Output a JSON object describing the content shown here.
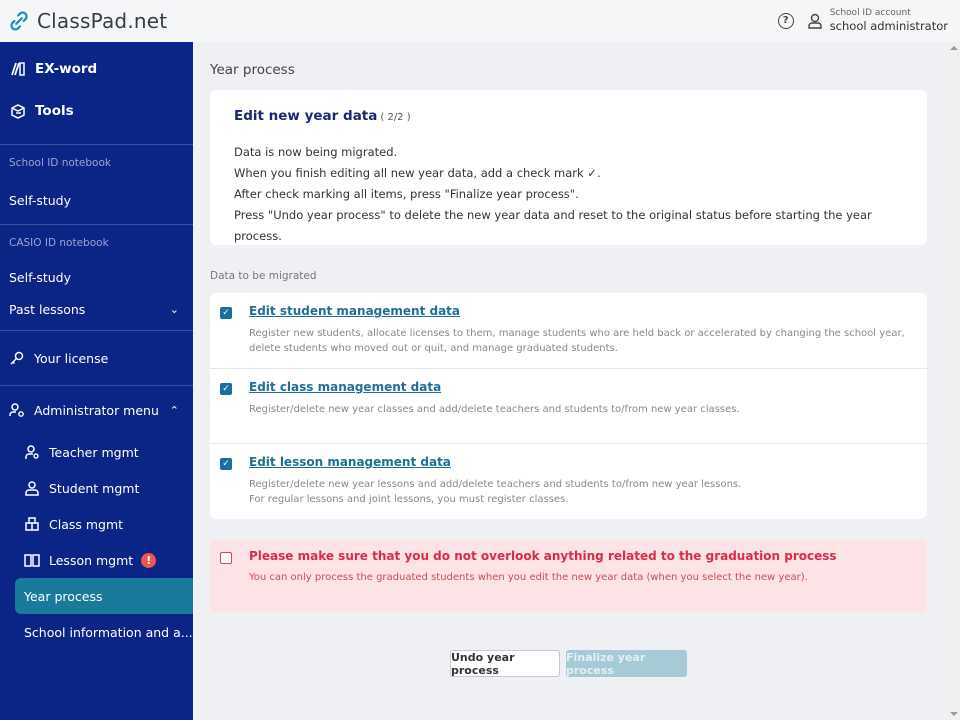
{
  "app": {
    "name": "ClassPad.net"
  },
  "header": {
    "help_icon": "?",
    "account_type": "School ID account",
    "account_name": "school administrator"
  },
  "sidebar": {
    "top_items": [
      {
        "label": "EX-word",
        "icon": "book-icon"
      },
      {
        "label": "Tools",
        "icon": "toolbox-icon"
      }
    ],
    "school_section": {
      "label": "School ID notebook",
      "items": [
        {
          "label": "Self-study"
        }
      ]
    },
    "casio_section": {
      "label": "CASIO ID notebook",
      "items": [
        {
          "label": "Self-study"
        },
        {
          "label": "Past lessons",
          "expandable": true,
          "expanded": false
        }
      ]
    },
    "license": {
      "label": "Your license"
    },
    "admin": {
      "label": "Administrator menu",
      "expanded": true,
      "items": [
        {
          "label": "Teacher mgmt"
        },
        {
          "label": "Student mgmt"
        },
        {
          "label": "Class mgmt"
        },
        {
          "label": "Lesson mgmt",
          "alert": "!"
        },
        {
          "label": "Year process",
          "active": true
        },
        {
          "label": "School information and a..."
        }
      ]
    }
  },
  "main": {
    "page_title": "Year process",
    "intro": {
      "title": "Edit new year data",
      "step": "( 2/2 )",
      "lines": [
        "Data is now being migrated.",
        "When you finish editing all new year data, add a check mark ✓.",
        "After check marking all items, press \"Finalize year process\".",
        "Press \"Undo year process\" to delete the new year data and reset to the original status before starting the year process."
      ]
    },
    "section_caption": "Data to be migrated",
    "items": [
      {
        "title": "Edit student management data",
        "checked": true,
        "desc": [
          "Register new students, allocate licenses to them, manage students who are held back or accelerated by changing the school year,",
          "delete students who moved out or quit, and manage graduated students."
        ]
      },
      {
        "title": "Edit class management data",
        "checked": true,
        "desc": [
          "Register/delete new year classes and add/delete teachers and students to/from new year classes."
        ]
      },
      {
        "title": "Edit lesson management data",
        "checked": true,
        "desc": [
          "Register/delete new year lessons and add/delete teachers and students to/from new year lessons.",
          "For regular lessons and joint lessons, you must register classes."
        ]
      }
    ],
    "warning": {
      "checked": false,
      "title": "Please make sure that you do not overlook anything related to the graduation process",
      "desc": "You can only process the graduated students when you edit the new year data (when you select the new year)."
    },
    "buttons": {
      "undo": "Undo year process",
      "finalize": "Finalize year process",
      "finalize_disabled": true
    }
  },
  "colors": {
    "sidebar_bg": "#0a2585",
    "active_item": "#1a7a9c",
    "link": "#1f6f9a",
    "warning_bg": "#fde2e6",
    "warning_text": "#d62e47"
  }
}
